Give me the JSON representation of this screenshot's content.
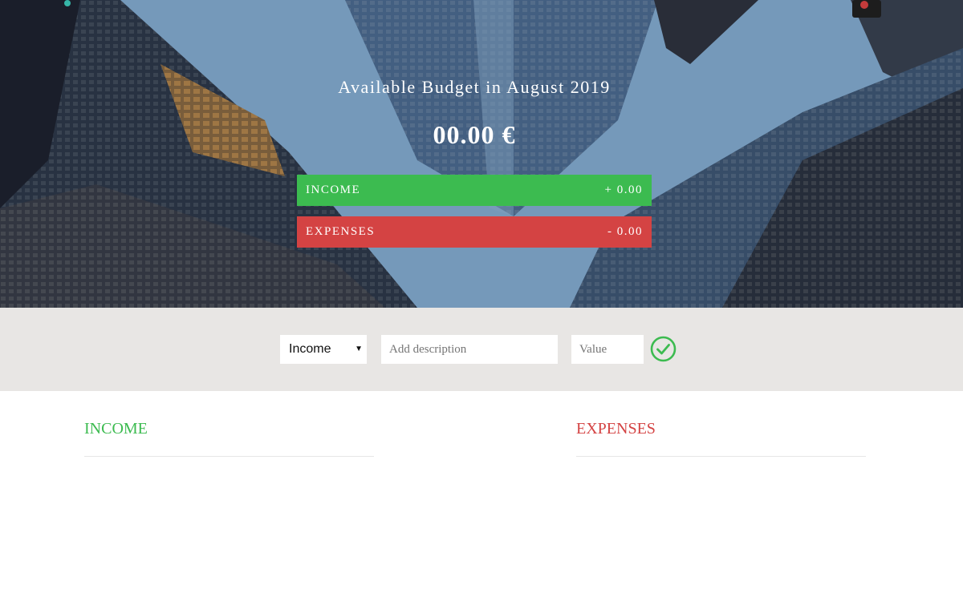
{
  "hero": {
    "title": "Available Budget in August 2019",
    "budget": "00.00 €",
    "income": {
      "label": "INCOME",
      "value": "+ 0.00"
    },
    "expenses": {
      "label": "EXPENSES",
      "value": "- 0.00"
    }
  },
  "add": {
    "type_selected": "Income",
    "description_placeholder": "Add description",
    "value_placeholder": "Value",
    "submit_icon": "check-circle-icon"
  },
  "lists": {
    "income_title": "INCOME",
    "expenses_title": "EXPENSES"
  },
  "colors": {
    "income": "#3cbb50",
    "expenses": "#d44343",
    "add_bar_bg": "#e8e6e4"
  }
}
